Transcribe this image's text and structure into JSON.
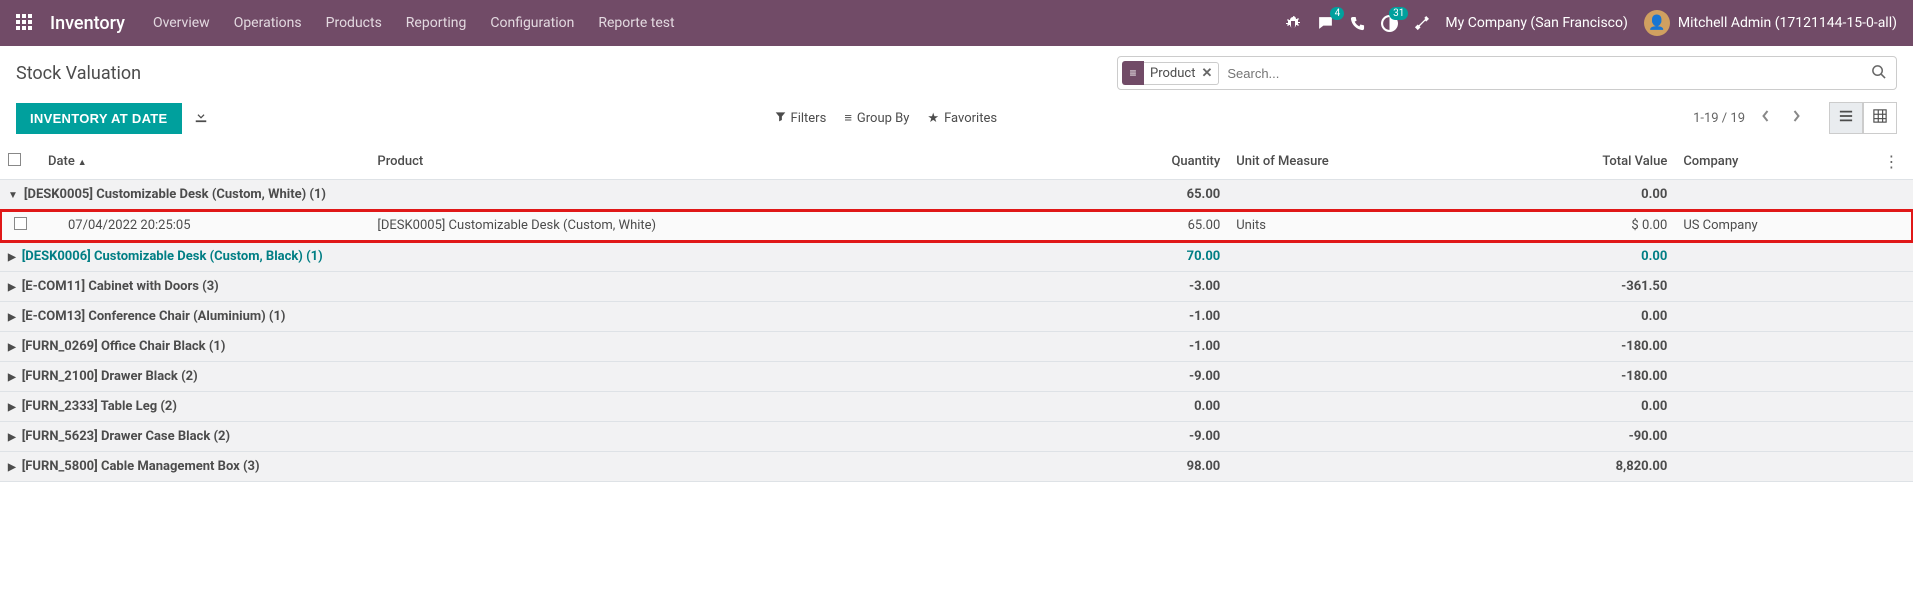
{
  "navbar": {
    "brand": "Inventory",
    "menu": [
      "Overview",
      "Operations",
      "Products",
      "Reporting",
      "Configuration",
      "Reporte test"
    ],
    "messaging_badge": "4",
    "activities_badge": "31",
    "company": "My Company (San Francisco)",
    "user_name": "Mitchell Admin (17121144-15-0-all)"
  },
  "page": {
    "title": "Stock Valuation",
    "primary_button": "INVENTORY AT DATE"
  },
  "search": {
    "facet_label": "Product",
    "placeholder": "Search..."
  },
  "toolbar": {
    "filters": "Filters",
    "group_by": "Group By",
    "favorites": "Favorites",
    "pager": "1-19 / 19"
  },
  "columns": {
    "date": "Date",
    "product": "Product",
    "quantity": "Quantity",
    "uom": "Unit of Measure",
    "total_value": "Total Value",
    "company": "Company"
  },
  "groups": [
    {
      "label": "[DESK0005] Customizable Desk (Custom, White) (1)",
      "qty": "65.00",
      "value": "0.00",
      "expanded": true,
      "link": false
    },
    {
      "label": "[DESK0006] Customizable Desk (Custom, Black) (1)",
      "qty": "70.00",
      "value": "0.00",
      "expanded": false,
      "link": true
    },
    {
      "label": "[E-COM11] Cabinet with Doors (3)",
      "qty": "-3.00",
      "value": "-361.50",
      "expanded": false,
      "link": false
    },
    {
      "label": "[E-COM13] Conference Chair (Aluminium) (1)",
      "qty": "-1.00",
      "value": "0.00",
      "expanded": false,
      "link": false
    },
    {
      "label": "[FURN_0269] Office Chair Black (1)",
      "qty": "-1.00",
      "value": "-180.00",
      "expanded": false,
      "link": false
    },
    {
      "label": "[FURN_2100] Drawer Black (2)",
      "qty": "-9.00",
      "value": "-180.00",
      "expanded": false,
      "link": false
    },
    {
      "label": "[FURN_2333] Table Leg (2)",
      "qty": "0.00",
      "value": "0.00",
      "expanded": false,
      "link": false
    },
    {
      "label": "[FURN_5623] Drawer Case Black (2)",
      "qty": "-9.00",
      "value": "-90.00",
      "expanded": false,
      "link": false
    },
    {
      "label": "[FURN_5800] Cable Management Box (3)",
      "qty": "98.00",
      "value": "8,820.00",
      "expanded": false,
      "link": false
    }
  ],
  "detail_row": {
    "date": "07/04/2022 20:25:05",
    "product": "[DESK0005] Customizable Desk (Custom, White)",
    "qty": "65.00",
    "uom": "Units",
    "value": "$ 0.00",
    "company": "US Company"
  }
}
